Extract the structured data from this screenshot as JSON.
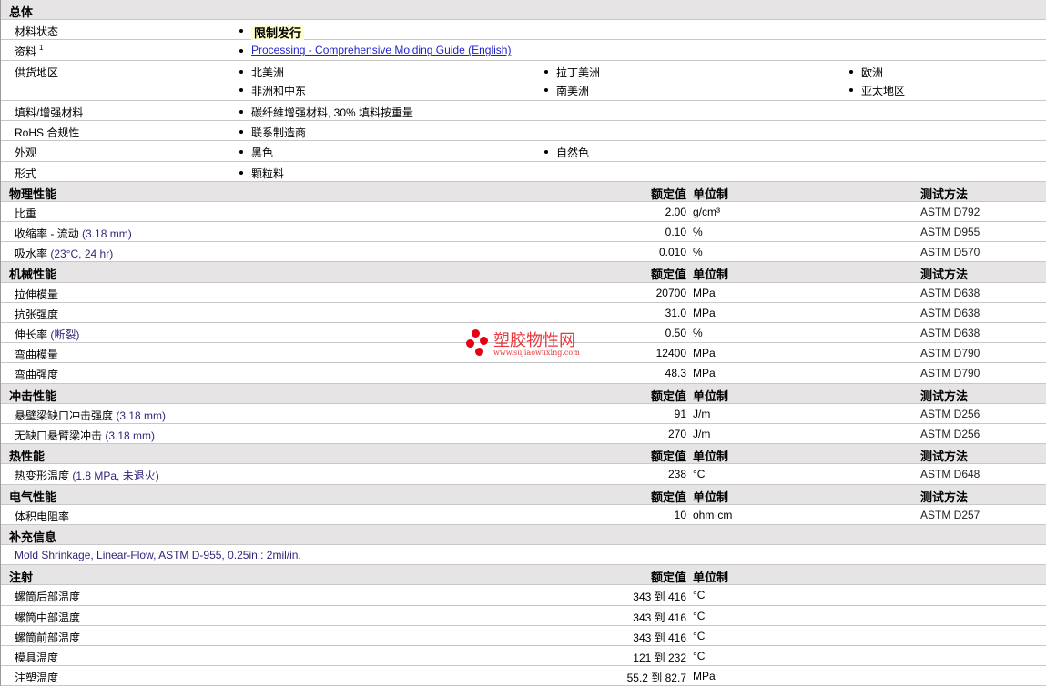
{
  "general": {
    "title": "总体",
    "rows": [
      {
        "label": "材料状态",
        "items": [
          "限制发行"
        ],
        "highlight": true
      },
      {
        "label": "资料",
        "sup": "1",
        "link": "Processing - Comprehensive Molding Guide (English)"
      },
      {
        "label": "供货地区",
        "items": [
          "北美洲",
          "拉丁美洲",
          "欧洲",
          "非洲和中东",
          "南美洲",
          "亚太地区"
        ]
      },
      {
        "label": "填料/增强材料",
        "items": [
          "碳纤維增强材料, 30% 填料按重量"
        ]
      },
      {
        "label": "RoHS 合规性",
        "items": [
          "联系制造商"
        ]
      },
      {
        "label": "外观",
        "items": [
          "黑色",
          "自然色"
        ]
      },
      {
        "label": "形式",
        "items": [
          "颗粒料"
        ]
      }
    ]
  },
  "headers": {
    "value": "额定值",
    "unit": "单位制",
    "test": "测试方法"
  },
  "sections": [
    {
      "title": "物理性能",
      "showTest": true,
      "rows": [
        {
          "label": "比重",
          "note": "",
          "value": "2.00",
          "unit": "g/cm³",
          "test": "ASTM D792"
        },
        {
          "label": "收缩率 - 流动",
          "note": "(3.18 mm)",
          "value": "0.10",
          "unit": "%",
          "test": "ASTM D955"
        },
        {
          "label": "吸水率",
          "note": "(23°C, 24 hr)",
          "value": "0.010",
          "unit": "%",
          "test": "ASTM D570"
        }
      ]
    },
    {
      "title": "机械性能",
      "showTest": true,
      "rows": [
        {
          "label": "拉伸模量",
          "note": "",
          "value": "20700",
          "unit": "MPa",
          "test": "ASTM D638"
        },
        {
          "label": "抗张强度",
          "note": "",
          "value": "31.0",
          "unit": "MPa",
          "test": "ASTM D638"
        },
        {
          "label": "伸长率",
          "note": "(断裂)",
          "value": "0.50",
          "unit": "%",
          "test": "ASTM D638"
        },
        {
          "label": "弯曲模量",
          "note": "",
          "value": "12400",
          "unit": "MPa",
          "test": "ASTM D790"
        },
        {
          "label": "弯曲强度",
          "note": "",
          "value": "48.3",
          "unit": "MPa",
          "test": "ASTM D790"
        }
      ]
    },
    {
      "title": "冲击性能",
      "showTest": true,
      "rows": [
        {
          "label": "悬壁梁缺口冲击强度",
          "note": "(3.18 mm)",
          "value": "91",
          "unit": "J/m",
          "test": "ASTM D256"
        },
        {
          "label": "无缺口悬臂梁冲击",
          "note": "(3.18 mm)",
          "value": "270",
          "unit": "J/m",
          "test": "ASTM D256"
        }
      ]
    },
    {
      "title": "热性能",
      "showTest": true,
      "rows": [
        {
          "label": "热变形温度",
          "note": "(1.8 MPa, 未退火)",
          "value": "238",
          "unit": "°C",
          "test": "ASTM D648"
        }
      ]
    },
    {
      "title": "电气性能",
      "showTest": true,
      "rows": [
        {
          "label": "体积电阻率",
          "note": "",
          "value": "10",
          "unit": "ohm·cm",
          "test": "ASTM D257"
        }
      ]
    },
    {
      "title": "补充信息",
      "plain": true,
      "rows": [
        {
          "label": "Mold Shrinkage, Linear-Flow, ASTM D-955, 0.25in.: 2mil/in."
        }
      ]
    },
    {
      "title": "注射",
      "showTest": false,
      "rows": [
        {
          "label": "螺筒后部温度",
          "note": "",
          "value": "343 到  416",
          "unit": "°C"
        },
        {
          "label": "螺筒中部温度",
          "note": "",
          "value": "343 到  416",
          "unit": "°C"
        },
        {
          "label": "螺筒前部温度",
          "note": "",
          "value": "343 到  416",
          "unit": "°C"
        },
        {
          "label": "模具温度",
          "note": "",
          "value": "121 到  232",
          "unit": "°C"
        },
        {
          "label": "注塑温度",
          "note": "",
          "value": "55.2 到  82.7",
          "unit": "MPa"
        }
      ]
    }
  ],
  "watermark": {
    "name": "塑胶物性网",
    "url": "www.sujiaowuxing.com"
  }
}
